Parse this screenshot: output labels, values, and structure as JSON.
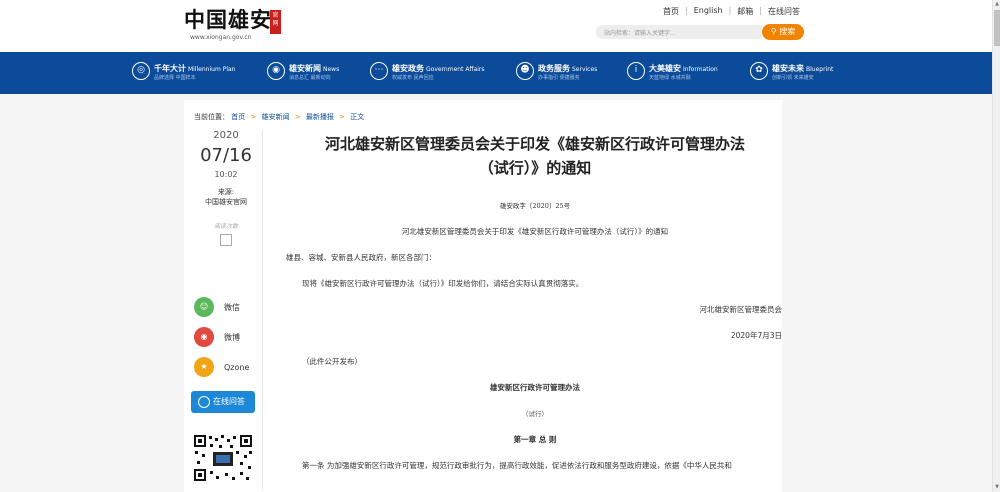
{
  "header": {
    "logo_text": "中国雄安",
    "logo_seal": "官网",
    "logo_url": "www.xiongan.gov.cn",
    "links": [
      "首页",
      "English",
      "邮箱",
      "在线问答"
    ],
    "search_placeholder": "站内检索：请输入关键字...",
    "search_button": "搜索"
  },
  "nav": [
    {
      "icon": "plan-icon",
      "title": "千年大计",
      "en": "Millennium Plan",
      "sub": "品牌选择 中国样本"
    },
    {
      "icon": "news-icon",
      "title": "雄安新闻",
      "en": "News",
      "sub": "消息总汇 最新动向"
    },
    {
      "icon": "gov-icon",
      "title": "雄安政务",
      "en": "Government Affairs",
      "sub": "权威发布 民声回应"
    },
    {
      "icon": "service-icon",
      "title": "政务服务",
      "en": "Services",
      "sub": "办事指引 便捷服务"
    },
    {
      "icon": "info-icon",
      "title": "大美雄安",
      "en": "Information",
      "sub": "天蓝地绿 水城共融"
    },
    {
      "icon": "blueprint-icon",
      "title": "雄安未来",
      "en": "Blueprint",
      "sub": "创新引领 未来雄安"
    }
  ],
  "breadcrumb": {
    "prefix": "当前位置：",
    "items": [
      "首页",
      "雄安新闻",
      "最新播报",
      "正文"
    ]
  },
  "sidebar": {
    "year": "2020",
    "month_day": "07/16",
    "time": "10:02",
    "source_label": "来源:",
    "source_value": "中国雄安官网",
    "read_count": "阅读次数",
    "share": [
      {
        "label": "微信",
        "color": "#5cb85c",
        "icon": "wechat-icon"
      },
      {
        "label": "微博",
        "color": "#e04a3f",
        "icon": "weibo-icon"
      },
      {
        "label": "Qzone",
        "color": "#f0a516",
        "icon": "qzone-icon"
      }
    ],
    "online_qa": "在线问答"
  },
  "article": {
    "title_line1": "河北雄安新区管理委员会关于印发《雄安新区行政许可管理办法",
    "title_line2": "（试行）》的通知",
    "doc_number": "雄安政字〔2020〕25号",
    "subtitle": "河北雄安新区管理委员会关于印发《雄安新区行政许可管理办法（试行）》的通知",
    "addressee": "雄县、容城、安新县人民政府，新区各部门：",
    "body": "现将《雄安新区行政许可管理办法（试行）》印发给你们，请结合实际认真贯彻落实。",
    "signer": "河北雄安新区管理委员会",
    "date": "2020年7月3日",
    "public_note": "（此件公开发布）",
    "doc_title": "雄安新区行政许可管理办法",
    "doc_trial": "（试行）",
    "chapter": "第一章 总 则",
    "article1": "第一条 为加强雄安新区行政许可管理，规范行政审批行为，提高行政效能，促进依法行政和服务型政府建设，依据《中华人民共和"
  },
  "colors": {
    "nav_bg": "#0b4b9a",
    "accent": "#f08300",
    "link": "#0b4b9a"
  }
}
